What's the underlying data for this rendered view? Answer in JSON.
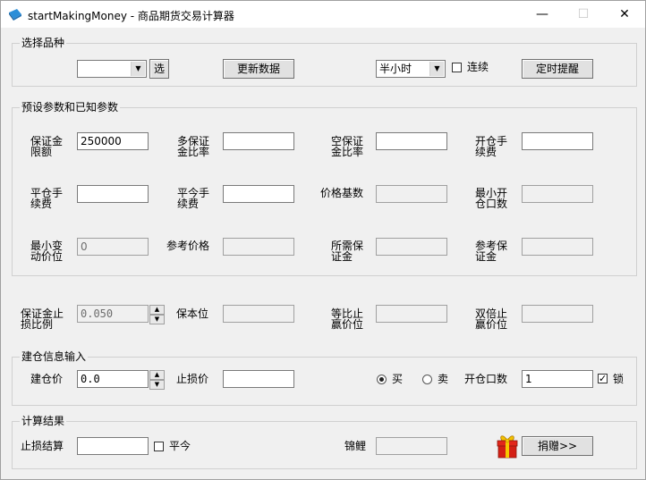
{
  "window": {
    "title": "startMakingMoney - 商品期货交易计算器",
    "minimize": "—",
    "maximize": "☐",
    "close": "✕"
  },
  "variety": {
    "group_label": "选择品种",
    "combo_value": "",
    "select_button": "选",
    "update_button": "更新数据",
    "period_value": "半小时",
    "continuous_label": "连续",
    "continuous_checked": false,
    "timer_button": "定时提醒"
  },
  "params": {
    "group_label": "预设参数和已知参数",
    "margin_limit_label": "保证金限额",
    "margin_limit_value": "250000",
    "long_margin_label": "多保证金比率",
    "long_margin_value": "",
    "short_margin_label": "空保证金比率",
    "short_margin_value": "",
    "open_fee_label": "开仓手续费",
    "open_fee_value": "",
    "close_fee_label": "平仓手续费",
    "close_fee_value": "",
    "close_today_fee_label": "平今手续费",
    "close_today_fee_value": "",
    "price_base_label": "价格基数",
    "price_base_value": "",
    "min_lots_label": "最小开仓口数",
    "min_lots_value": "",
    "min_tick_label": "最小变动价位",
    "min_tick_value": "0",
    "ref_price_label": "参考价格",
    "ref_price_value": "",
    "required_margin_label": "所需保证金",
    "required_margin_value": "",
    "ref_margin_label": "参考保证金",
    "ref_margin_value": ""
  },
  "stops": {
    "stop_ratio_label": "保证金止损比例",
    "stop_ratio_value": "0.050",
    "breakeven_label": "保本位",
    "breakeven_value": "",
    "equal_tp_label": "等比止赢价位",
    "equal_tp_value": "",
    "double_tp_label": "双倍止赢价位",
    "double_tp_value": ""
  },
  "entry": {
    "group_label": "建仓信息输入",
    "entry_price_label": "建仓价",
    "entry_price_value": "0.0",
    "stop_price_label": "止损价",
    "stop_price_value": "",
    "buy_label": "买",
    "buy_selected": true,
    "sell_label": "卖",
    "sell_selected": false,
    "lots_label": "开仓口数",
    "lots_value": "1",
    "lock_label": "锁",
    "lock_checked": true
  },
  "result": {
    "group_label": "计算结果",
    "stop_settle_label": "止损结算",
    "stop_settle_value": "",
    "close_today_label": "平今",
    "close_today_checked": false,
    "koi_label": "锦鲤",
    "koi_value": "",
    "donate_button": "捐赠>>"
  }
}
